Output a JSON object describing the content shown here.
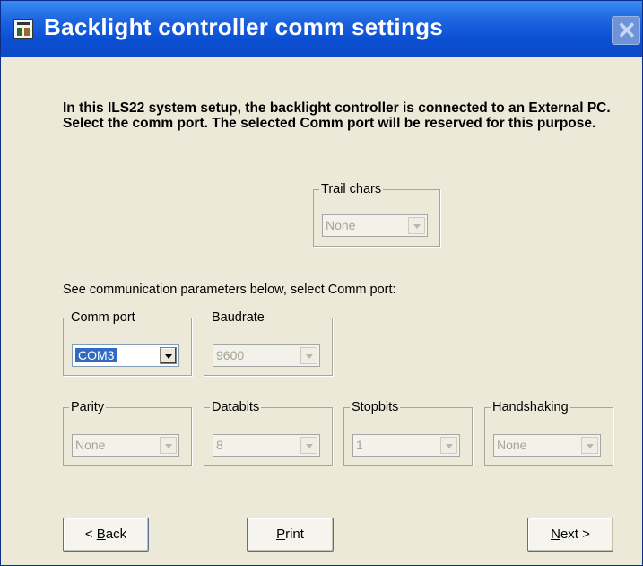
{
  "window": {
    "title": "Backlight controller comm settings",
    "close_glyph": "✕",
    "colors": {
      "titlebar": "#0a4fd3",
      "body": "#ece9d8",
      "selection": "#316ac5"
    }
  },
  "intro_text": "In this ILS22 system setup, the backlight controller is connected to an External PC. Select the comm port. The selected Comm port will be reserved for this purpose.",
  "comm_hint": "See communication parameters below, select Comm port:",
  "groups": {
    "trail_chars": {
      "legend": "Trail chars",
      "value": "None",
      "enabled": false
    },
    "comm_port": {
      "legend": "Comm port",
      "value": "COM3",
      "enabled": true
    },
    "baudrate": {
      "legend": "Baudrate",
      "value": "9600",
      "enabled": false
    },
    "parity": {
      "legend": "Parity",
      "value": "None",
      "enabled": false
    },
    "databits": {
      "legend": "Databits",
      "value": "8",
      "enabled": false
    },
    "stopbits": {
      "legend": "Stopbits",
      "value": "1",
      "enabled": false
    },
    "handshaking": {
      "legend": "Handshaking",
      "value": "None",
      "enabled": false
    }
  },
  "buttons": {
    "back": {
      "prefix": "< ",
      "accel": "B",
      "rest": "ack"
    },
    "print": {
      "accel": "P",
      "rest": "rint"
    },
    "next": {
      "accel": "N",
      "rest": "ext >"
    }
  },
  "icons": [
    "app-icon",
    "close-icon",
    "chevron-down-icon"
  ]
}
